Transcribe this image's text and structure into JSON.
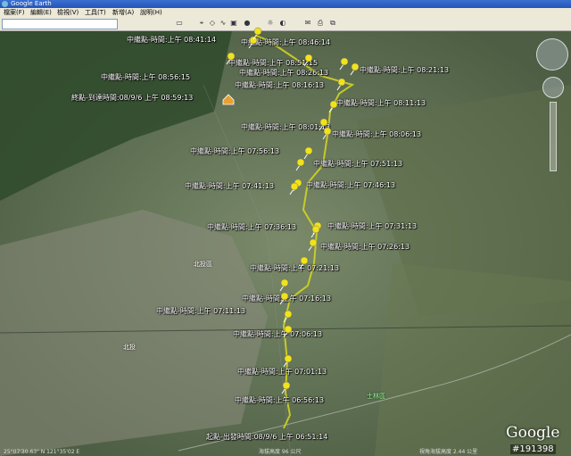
{
  "window": {
    "title": "Google Earth"
  },
  "menu": [
    "檔案(F)",
    "編輯(E)",
    "檢視(V)",
    "工具(T)",
    "新增(A)",
    "說明(H)"
  ],
  "toolbar_icons": [
    "hide-sidebar-icon",
    "placemark-icon",
    "polygon-icon",
    "path-icon",
    "overlay-icon",
    "record-tour-icon",
    "historical-imagery-icon",
    "sun-icon",
    "planets-icon",
    "ruler-icon",
    "email-icon",
    "print-icon",
    "view-in-maps-icon"
  ],
  "search": {
    "value": ""
  },
  "labels": {
    "end": "終點-到達時間:08/9/6 上午 08:59:13",
    "start": "起點-出發時間:08/9/6 上午 06:51:14",
    "waypoints": [
      "中繼點-時間:上午 08:41:14",
      "中繼點-時間:上午 08:46:14",
      "中繼點-時間:上午 08:51:15",
      "中繼點-時間:上午 08:56:15",
      "中繼點-時間:上午 08:26:13",
      "中繼點-時間:上午 08:21:13",
      "中繼點-時間:上午 08:16:13",
      "中繼點-時間:上午 08:11:13",
      "中繼點-時間:上午 08:01:13",
      "中繼點-時間:上午 08:06:13",
      "中繼點-時間:上午 07:56:13",
      "中繼點-時間:上午 07:51:13",
      "中繼點-時間:上午 07:41:13",
      "中繼點-時間:上午 07:46:13",
      "中繼點-時間:上午 07:36:13",
      "中繼點-時間:上午 07:31:13",
      "中繼點-時間:上午 07:26:13",
      "中繼點-時間:上午 07:21:13",
      "中繼點-時間:上午 07:16:13",
      "中繼點-時間:上午 07:11:13",
      "中繼點-時間:上午 07:06:13",
      "中繼點-時間:上午 07:01:13",
      "中繼點-時間:上午 06:56:13"
    ]
  },
  "places": {
    "beitou": "北投區",
    "shilin": "士林區",
    "shilin2": "士林",
    "taipei": "北投"
  },
  "logo": "Google",
  "watermark": "#191398",
  "status": {
    "left": "25°07'30.63\" N 121°35'02 E",
    "mid": "海拔高度 96 公尺",
    "right": "視角海拔高度 2.44 公里"
  },
  "colors": {
    "track": "#d8d820",
    "pin": "#f2e21a"
  }
}
